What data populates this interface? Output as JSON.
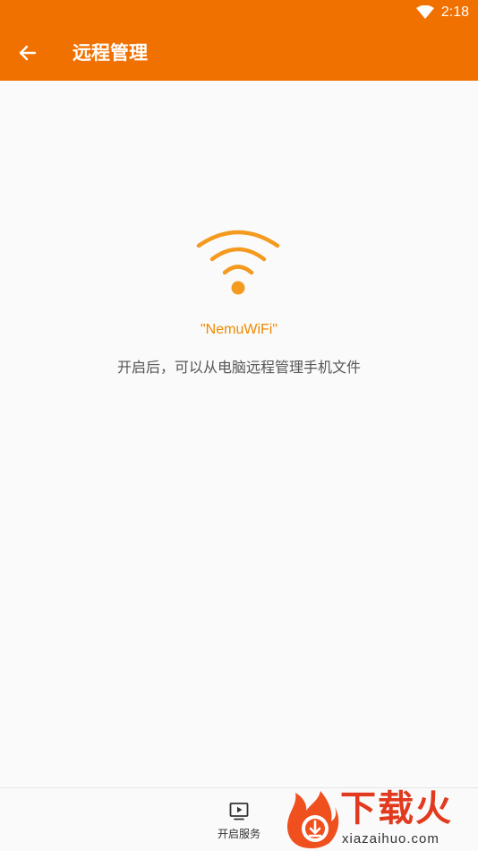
{
  "status_bar": {
    "time": "2:18",
    "wifi_icon": "wifi-signal-icon"
  },
  "appbar": {
    "back_icon": "arrow-left-icon",
    "title": "远程管理",
    "color": "#f07000"
  },
  "main": {
    "wifi_icon": "wifi-icon",
    "ssid": "\"NemuWiFi\"",
    "hint": "开启后，可以从电脑远程管理手机文件",
    "accent_color": "#ef8a00"
  },
  "bottom": {
    "start_icon": "screen-play-icon",
    "start_label": "开启服务"
  },
  "watermark": {
    "title": "下载火",
    "subtitle": "xiazaihuo.com",
    "icon": "fire-download-logo-icon"
  }
}
